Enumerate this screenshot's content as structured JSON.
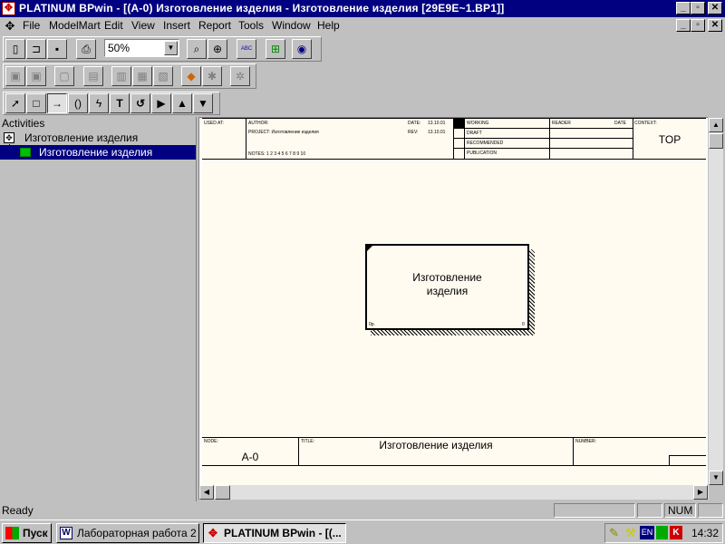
{
  "window": {
    "title": "PLATINUM BPwin - [(A-0) Изготовление изделия - Изготовление изделия  [29E9E~1.BP1]]",
    "icon": "bpwin-app-icon"
  },
  "menu": [
    "File",
    "ModelMart",
    "Edit",
    "View",
    "Insert",
    "Report",
    "Tools",
    "Window",
    "Help"
  ],
  "toolbar": {
    "zoom_value": "50%",
    "spell_label": "ABC"
  },
  "palette": {
    "text_tool": "T"
  },
  "tree": {
    "header": "Activities",
    "root": "Изготовление изделия",
    "child": "Изготовление изделия"
  },
  "diagram": {
    "header": {
      "used_at": "USED AT:",
      "author": "AUTHOR:",
      "project": "PROJECT: Изготовление изделия",
      "date_label": "DATE:",
      "date": "13.10.01",
      "rev_label": "REV:",
      "rev": "13.10.01",
      "notes": "NOTES:  1  2  3  4  5  6  7  8  9  10",
      "working": "WORKING",
      "draft": "DRAFT",
      "recommended": "RECOMMENDED",
      "publication": "PUBLICATION",
      "reader": "READER",
      "date2": "DATE",
      "context": "CONTEXT:",
      "context_value": "TOP"
    },
    "activity": {
      "label_line1": "Изготовление",
      "label_line2": "изделия",
      "number": "0p.",
      "corner": "0"
    },
    "footer": {
      "node_label": "NODE:",
      "node_value": "A-0",
      "title_label": "TITLE:",
      "title_value": "Изготовление изделия",
      "number_label": "NUMBER:"
    }
  },
  "status": {
    "text": "Ready",
    "num": "NUM"
  },
  "taskbar": {
    "start": "Пуск",
    "tasks": [
      "Лабораторная работа 2 - ...",
      "PLATINUM BPwin - [(..."
    ],
    "lang": "EN",
    "clock": "14:32"
  }
}
